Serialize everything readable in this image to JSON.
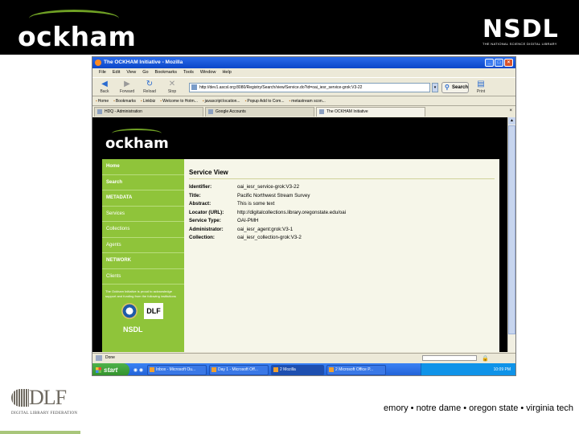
{
  "slide": {
    "logo_text": "ockham",
    "nsdl_logo": "NSDL",
    "nsdl_tagline": "THE NATIONAL SCIENCE DIGITAL LIBRARY",
    "footer_logo": "DLF",
    "footer_logo_caption": "DIGITAL LIBRARY FEDERATION",
    "footer_text": "emory • notre dame • oregon state • virginia tech"
  },
  "browser": {
    "window_title": "The OCKHAM Initiative - Mozilla",
    "menu": [
      "File",
      "Edit",
      "View",
      "Go",
      "Bookmarks",
      "Tools",
      "Window",
      "Help"
    ],
    "toolbar": {
      "back": "Back",
      "forward": "Forward",
      "reload": "Reload",
      "stop": "Stop",
      "print": "Print"
    },
    "address": "http://dev1.ascsl.org:8080/Registry/Search/view/Service.do?id=oai_iesr_service-grok:V3-22",
    "search_label": "Search",
    "bookmarks": [
      "Home",
      "Bookmarks",
      "Linkbiz",
      "Welcome to Hotm...",
      "javascript:location...",
      "Popup Add to Com...",
      "metastream scon..."
    ],
    "tabs": [
      "HDQ - Administration",
      "Google Accounts",
      "The OCKHAM Initiative"
    ],
    "status": "Done"
  },
  "page": {
    "logo_text": "ockham",
    "nav": [
      "Home",
      "Search",
      "METADATA",
      "Services",
      "Collections",
      "Agents",
      "NETWORK",
      "Clients"
    ],
    "sponsor_text": "The Ockham Initiative is proud to acknowledge support and funding from the following institutions",
    "sponsor_dlf": "DLF",
    "sponsor_nsdl": "NSDL",
    "title": "Service View",
    "fields": [
      {
        "label": "Identifier:",
        "value": "oai_iesr_service-grok:V3-22"
      },
      {
        "label": "Title:",
        "value": "Pacific Northwest Stream Survey"
      },
      {
        "label": "Abstract:",
        "value": "This is some text"
      },
      {
        "label": "Locator (URL):",
        "value": "http://digitalcollections.library.oregonstate.edu/oai"
      },
      {
        "label": "Service Type:",
        "value": "OAI-PMH"
      },
      {
        "label": "Administrator:",
        "value": "oai_iesr_agent:grok:V3-1"
      },
      {
        "label": "Collection:",
        "value": "oai_iesr_collection-grok:V3-2"
      }
    ]
  },
  "taskbar": {
    "start": "start",
    "items": [
      "Inbox - Microsoft Ou...",
      "Day 1 - Microsoft Off...",
      "2 Mozilla",
      "2 Microsoft Office P..."
    ],
    "clock": "10:09 PM"
  }
}
